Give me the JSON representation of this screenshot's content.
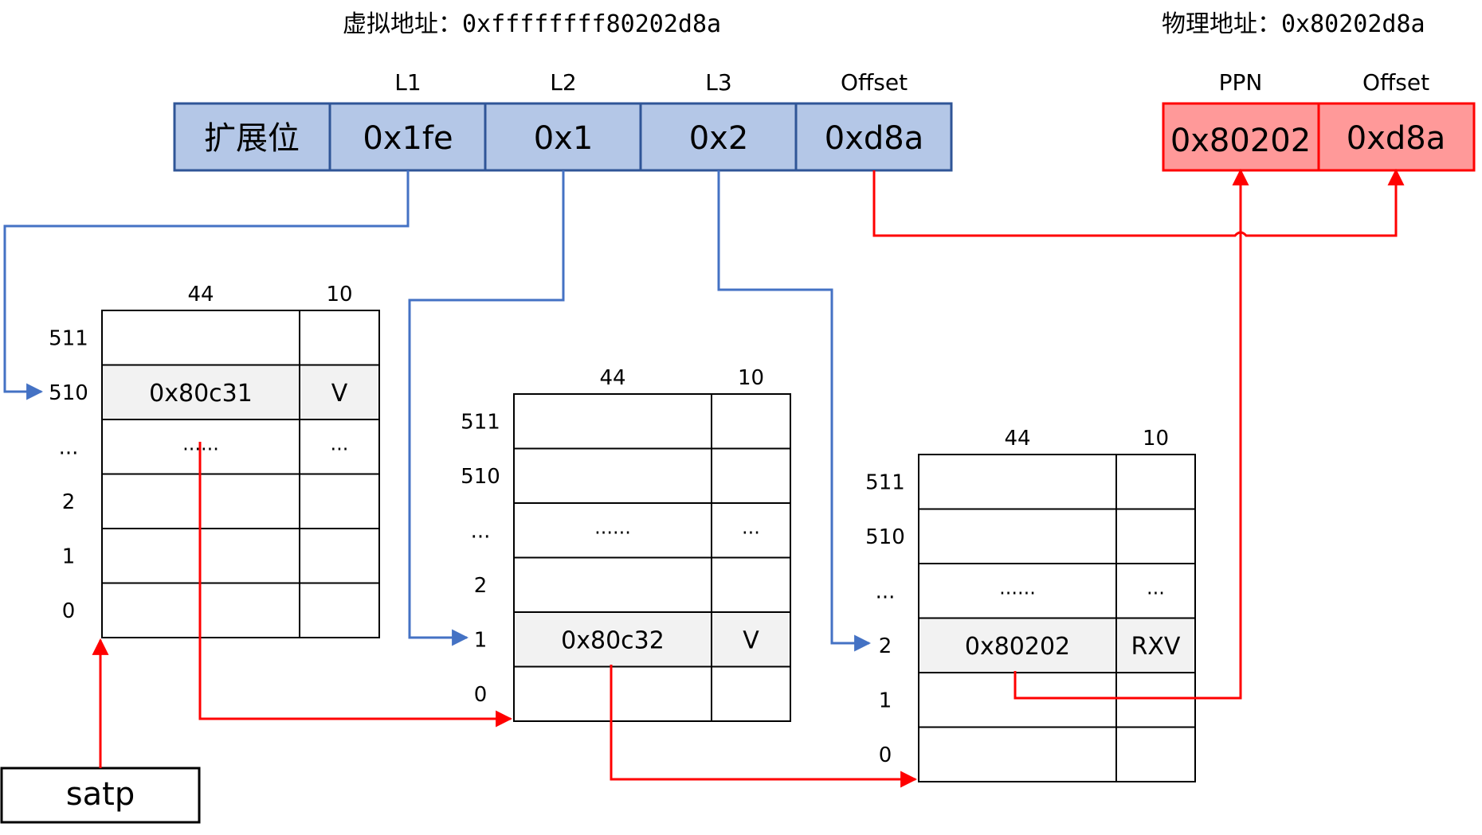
{
  "header": {
    "virtual_label": "虚拟地址：",
    "virtual_value": "0xffffffff80202d8a",
    "physical_label": "物理地址：",
    "physical_value": "0x80202d8a"
  },
  "virtual_address": {
    "headers": [
      "",
      "L1",
      "L2",
      "L3",
      "Offset"
    ],
    "cells": [
      "扩展位",
      "0x1fe",
      "0x1",
      "0x2",
      "0xd8a"
    ]
  },
  "physical_address": {
    "headers": [
      "PPN",
      "Offset"
    ],
    "cells": [
      "0x80202",
      "0xd8a"
    ]
  },
  "tables": [
    {
      "col_headers": [
        "44",
        "10"
      ],
      "row_labels": [
        "511",
        "510",
        "...",
        "2",
        "1",
        "0"
      ],
      "rows": [
        [
          "",
          ""
        ],
        [
          "0x80c31",
          "V"
        ],
        [
          "......",
          "..."
        ],
        [
          "",
          ""
        ],
        [
          "",
          ""
        ],
        [
          "",
          ""
        ]
      ],
      "highlight_row": 1
    },
    {
      "col_headers": [
        "44",
        "10"
      ],
      "row_labels": [
        "511",
        "510",
        "...",
        "2",
        "1",
        "0"
      ],
      "rows": [
        [
          "",
          ""
        ],
        [
          "",
          ""
        ],
        [
          "......",
          "..."
        ],
        [
          "",
          ""
        ],
        [
          "0x80c32",
          "V"
        ],
        [
          "",
          ""
        ]
      ],
      "highlight_row": 4
    },
    {
      "col_headers": [
        "44",
        "10"
      ],
      "row_labels": [
        "511",
        "510",
        "...",
        "2",
        "1",
        "0"
      ],
      "rows": [
        [
          "",
          ""
        ],
        [
          "",
          ""
        ],
        [
          "......",
          "..."
        ],
        [
          "0x80202",
          "RXV"
        ],
        [
          "",
          ""
        ],
        [
          "",
          ""
        ]
      ],
      "highlight_row": 3
    }
  ],
  "satp": {
    "label": "satp"
  },
  "colors": {
    "va_fill": "#b4c7e7",
    "va_stroke": "#2f5597",
    "pa_fill": "#ff9999",
    "pa_stroke": "#ff0000",
    "blue_arrow": "#4472c4",
    "red_arrow": "#ff0000",
    "highlight_row": "#f2f2f2"
  }
}
